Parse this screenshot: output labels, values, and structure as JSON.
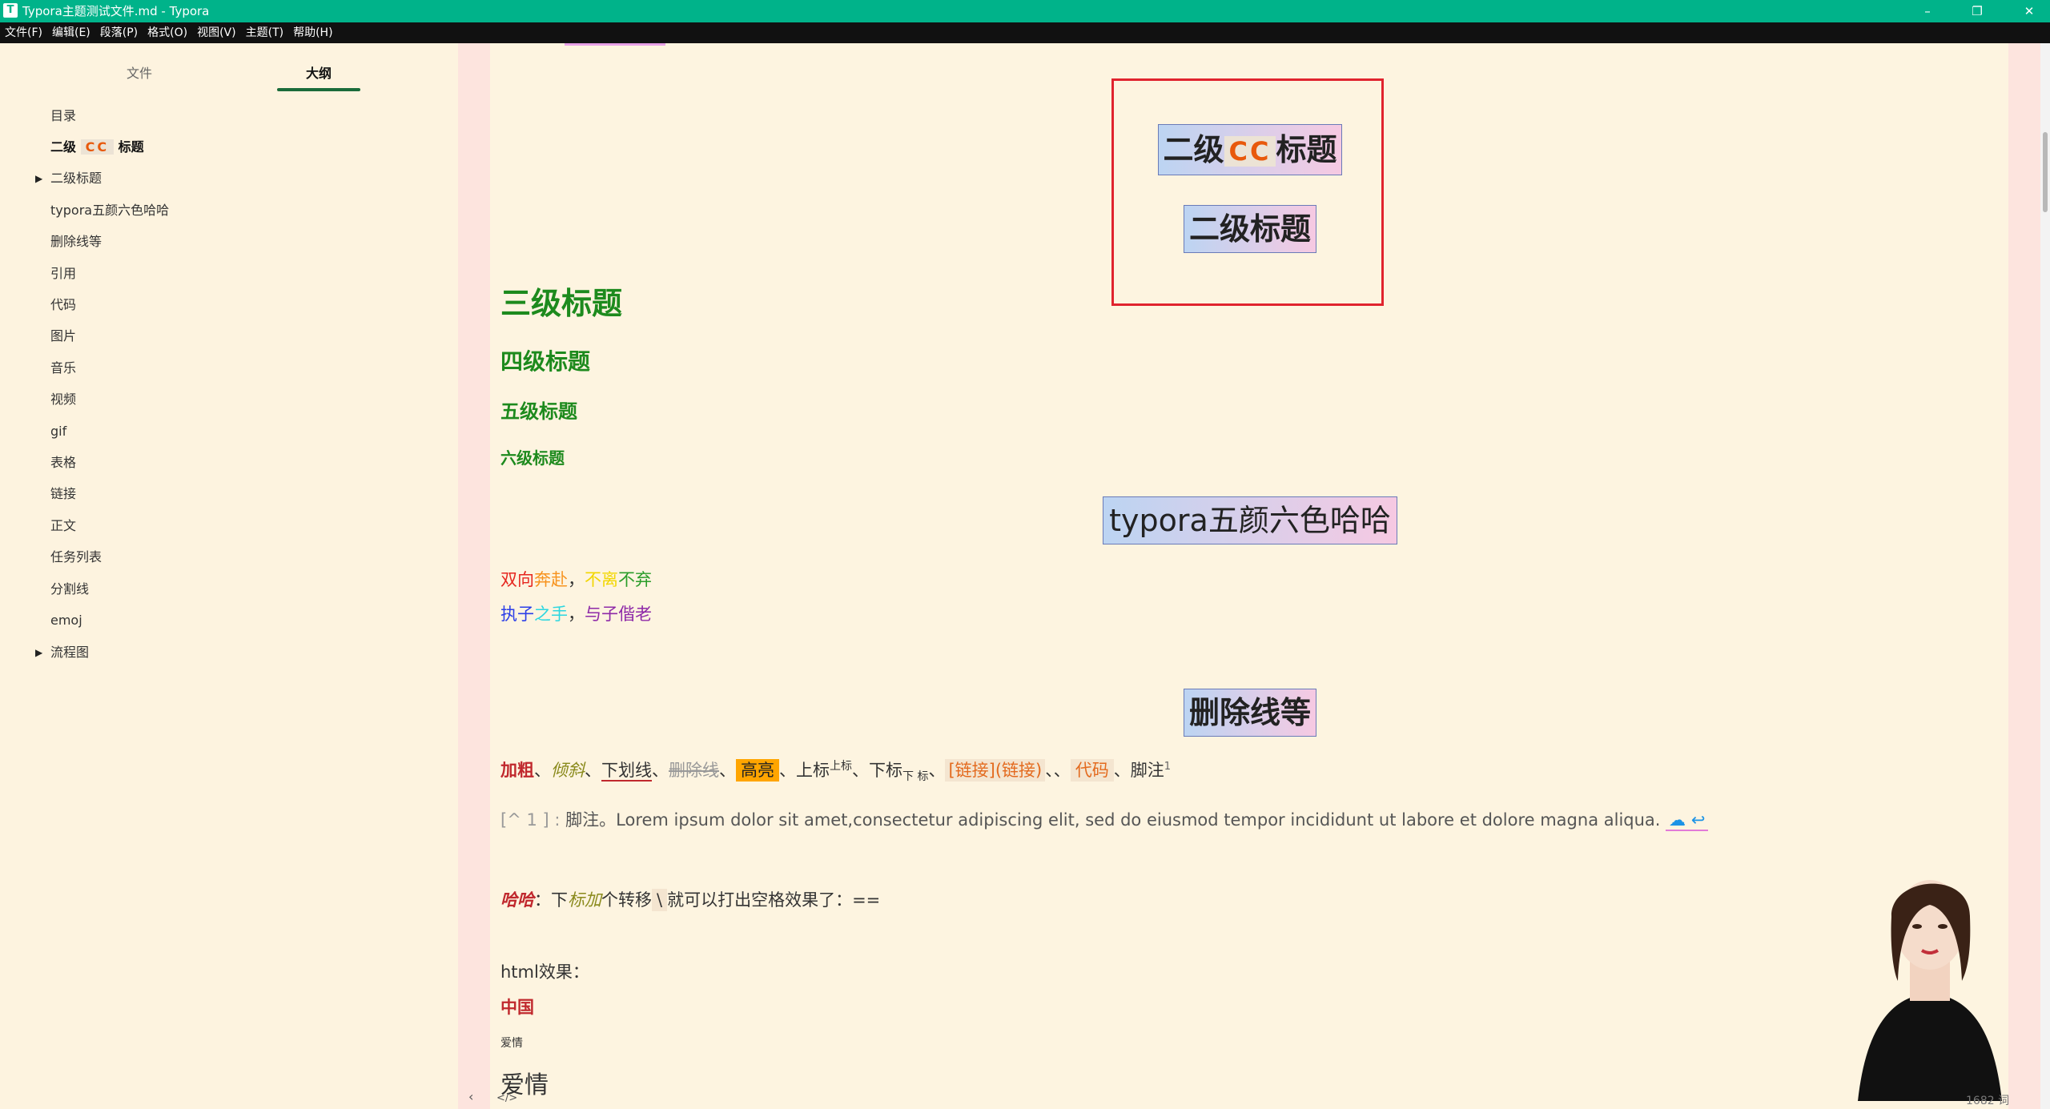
{
  "window": {
    "title": "Typora主题测试文件.md - Typora",
    "app_icon": "T",
    "controls": [
      "minimize-icon",
      "restore-icon",
      "close-icon"
    ]
  },
  "menu": [
    "文件(F)",
    "编辑(E)",
    "段落(P)",
    "格式(O)",
    "视图(V)",
    "主题(T)",
    "帮助(H)"
  ],
  "sidebar": {
    "tabs": [
      "文件",
      "大纲"
    ],
    "active_tab": "大纲",
    "outline": [
      {
        "label": "目录"
      },
      {
        "label_pre": "二级",
        "label_cc": "CC",
        "label_post": "标题",
        "bold": true
      },
      {
        "label": "二级标题",
        "collapsed": true
      },
      {
        "label": "typora五颜六色哈哈"
      },
      {
        "label": "删除线等"
      },
      {
        "label": "引用"
      },
      {
        "label": "代码"
      },
      {
        "label": "图片"
      },
      {
        "label": "音乐"
      },
      {
        "label": "视频"
      },
      {
        "label": "gif"
      },
      {
        "label": "表格"
      },
      {
        "label": "链接"
      },
      {
        "label": "正文"
      },
      {
        "label": "任务列表"
      },
      {
        "label": "分割线"
      },
      {
        "label": "emoj"
      },
      {
        "label": "流程图",
        "collapsed": true
      }
    ]
  },
  "doc": {
    "h2_cc_pre": "二级",
    "h2_cc_mid": "CC",
    "h2_cc_post": "标题",
    "h2_plain": "二级标题",
    "h3": "三级标题",
    "h4": "四级标题",
    "h5": "五级标题",
    "h6": "六级标题",
    "h2_colorful": "typora五颜六色哈哈",
    "color_line1": [
      "双向",
      "奔赴",
      "，",
      "不离",
      "不弃"
    ],
    "color_line2": [
      "执子",
      "之手",
      "，",
      "与子偕老"
    ],
    "h2_strike": "删除线等",
    "fmt": {
      "bold": "加粗",
      "sep1": "、",
      "italic": "倾斜",
      "sep2": "、",
      "underline": "下划线",
      "sep3": "、",
      "strike": "删除线",
      "sep4": "、",
      "highlight": "高亮",
      "sep5": "、",
      "sup_base": "上标",
      "sup": "上标",
      "sep6": "、",
      "sub_base": "下标",
      "sub": "下 标",
      "sep7": "、",
      "link": "[链接](链接)",
      "sep8": "、、",
      "code": "代码",
      "sep9": "、",
      "footnote": "脚注",
      "fn_num": "1"
    },
    "footnote_line": {
      "label": "[^ 1 ] :",
      "text": "脚注。Lorem ipsum dolor sit amet,consectetur adipiscing elit, sed do eiusmod tempor incididunt ut labore et dolore magna aliqua.",
      "back": "↩"
    },
    "haha": {
      "strong": "哈哈",
      "colon": "：下",
      "em": "标加",
      "mid": "个转移",
      "code": "\\",
      "tail": "就可以打出空格效果了：=="
    },
    "html_effect": "html效果：",
    "china": "中国",
    "love_small": "爱情",
    "love_big": "爱情"
  },
  "status": {
    "word_count": "1682 词",
    "source_toggle": "</>",
    "sidebar_toggle": "‹"
  },
  "colors": {
    "titlebar": "#00b38a",
    "heading_green": "#1d8a1d",
    "red_rect": "#e0232e",
    "highlight": "#ffa500"
  }
}
